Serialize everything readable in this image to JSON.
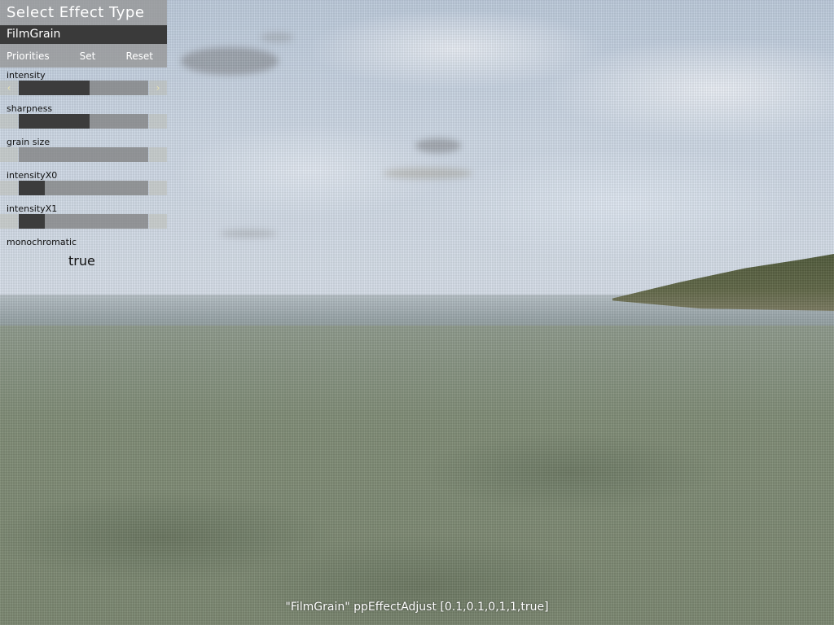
{
  "panel": {
    "title": "Select Effect Type",
    "selected_effect": "FilmGrain",
    "buttons": {
      "priorities": "Priorities",
      "set": "Set",
      "reset": "Reset"
    },
    "params": [
      {
        "label": "intensity",
        "fraction": 0.55
      },
      {
        "label": "sharpness",
        "fraction": 0.55
      },
      {
        "label": "grain size",
        "fraction": 0.0
      },
      {
        "label": "intensityX0",
        "fraction": 0.2
      },
      {
        "label": "intensityX1",
        "fraction": 0.2
      }
    ],
    "monochromatic": {
      "label": "monochromatic",
      "value": "true"
    },
    "arrow_left": "‹",
    "arrow_right": "›"
  },
  "status_text": "\"FilmGrain\" ppEffectAdjust [0.1,0.1,0,1,1,true]"
}
